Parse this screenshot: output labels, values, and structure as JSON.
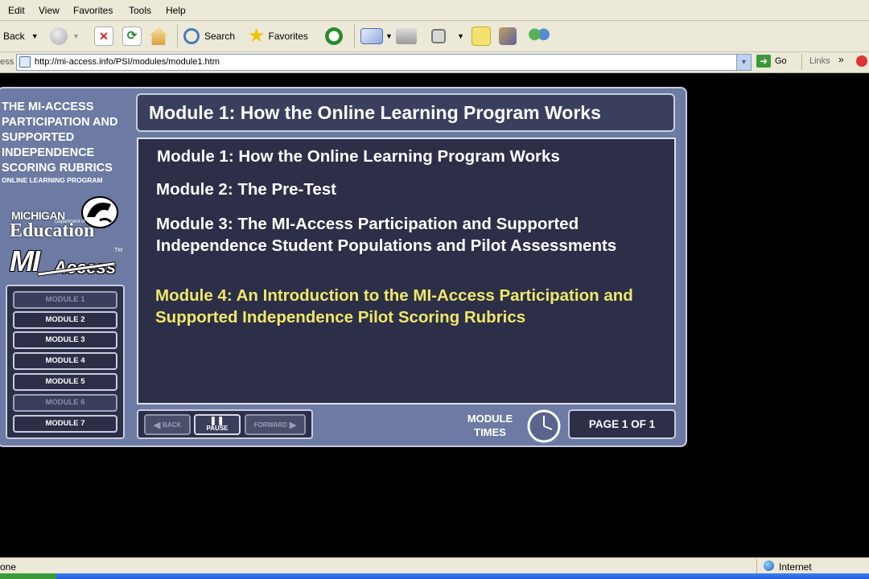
{
  "browser": {
    "menu": [
      "Edit",
      "View",
      "Favorites",
      "Tools",
      "Help"
    ],
    "toolbar": {
      "back_label": "Back",
      "search_label": "Search",
      "favorites_label": "Favorites"
    },
    "address": {
      "label": "ess",
      "url": "http://mi-access.info/PSI/modules/module1.htm",
      "go_label": "Go",
      "links_label": "Links",
      "chevron": "»"
    },
    "status": {
      "left_text": "one",
      "zone_text": "Internet"
    }
  },
  "sidebar": {
    "program_title": "THE MI-ACCESS PARTICIPATION AND SUPPORTED INDEPENDENCE SCORING RUBRICS",
    "program_subtitle": "ONLINE LEARNING PROGRAM",
    "mde_logo": {
      "line1": "MICHIGAN",
      "line2": "Department of",
      "line3": "Education"
    },
    "mi_access_logo": {
      "mi": "MI",
      "access": "Access",
      "tm": "TM"
    },
    "modules": [
      {
        "label": "MODULE 1",
        "state": "dimmed"
      },
      {
        "label": "MODULE 2",
        "state": "enabled"
      },
      {
        "label": "MODULE 3",
        "state": "enabled"
      },
      {
        "label": "MODULE 4",
        "state": "enabled"
      },
      {
        "label": "MODULE 5",
        "state": "enabled"
      },
      {
        "label": "MODULE 6",
        "state": "dimmed"
      },
      {
        "label": "MODULE 7",
        "state": "enabled"
      }
    ]
  },
  "main": {
    "title": "Module 1:  How the Online Learning Program Works",
    "items": [
      {
        "text": "Module 1:  How the Online Learning Program Works",
        "highlight": false
      },
      {
        "text": "Module 2:  The Pre-Test",
        "highlight": false
      },
      {
        "text": "Module 3:  The MI-Access Participation and Supported Independence Student Populations and Pilot Assessments",
        "highlight": false
      },
      {
        "text": "Module 4:  An Introduction to the MI-Access Participation and Supported Independence Pilot Scoring Rubrics",
        "highlight": true
      }
    ],
    "highlight_color": "#f0e86a"
  },
  "controls": {
    "back_label": "BACK",
    "pause_label": "PAUSE",
    "forward_label": "FORWARD",
    "module_times_label": "MODULE TIMES",
    "page_indicator": "PAGE 1 OF 1"
  }
}
